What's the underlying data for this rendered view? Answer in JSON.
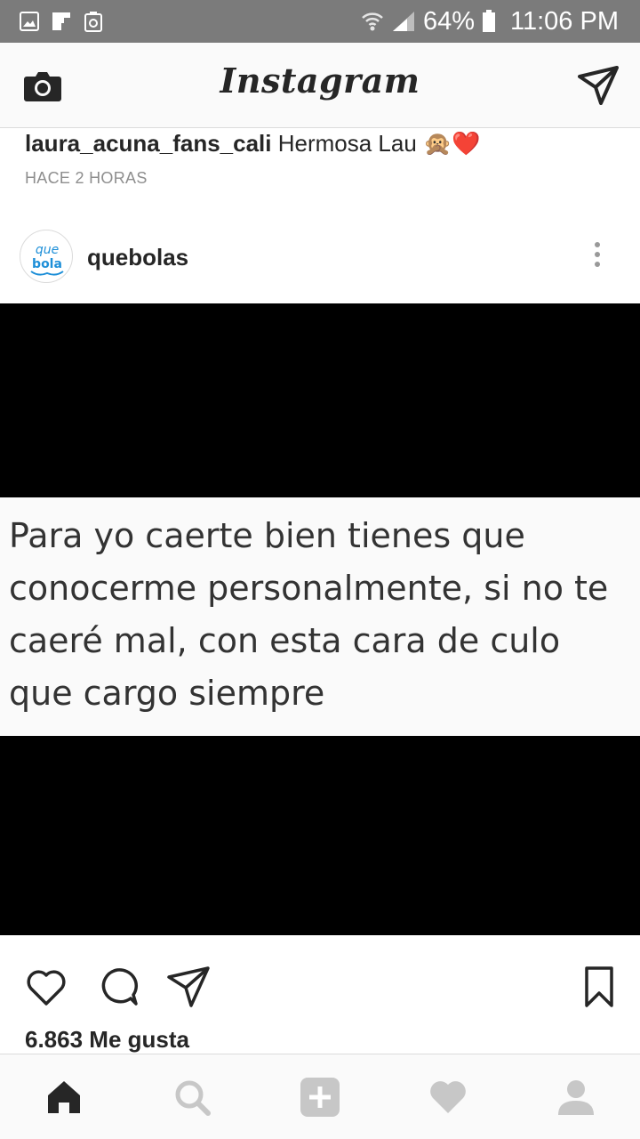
{
  "status_bar": {
    "battery": "64%",
    "time": "11:06 PM",
    "icons": [
      "gallery-icon",
      "flipboard-icon",
      "recycle-icon",
      "wifi-icon",
      "signal-icon",
      "battery-icon"
    ]
  },
  "header": {
    "logo": "Instagram",
    "left_icon": "camera-icon",
    "right_icon": "direct-send-icon"
  },
  "previous_caption": {
    "username": "laura_acuna_fans_cali",
    "text": "Hermosa Lau 🙊❤️",
    "time": "HACE 2 HORAS"
  },
  "post": {
    "username": "quebolas",
    "avatar_text": "que bola",
    "image_text": "Para yo caerte bien tienes que conocerme personalmente, si no te caeré mal, con esta cara de culo que cargo siempre",
    "likes": "6.863 Me gusta"
  },
  "bottom_nav": [
    "home-icon",
    "search-icon",
    "add-icon",
    "activity-heart-icon",
    "profile-icon"
  ],
  "colors": {
    "status_bar": "#7b7b7b",
    "text": "#262626",
    "muted": "#8e8e8e",
    "border": "#dbdbdb"
  }
}
